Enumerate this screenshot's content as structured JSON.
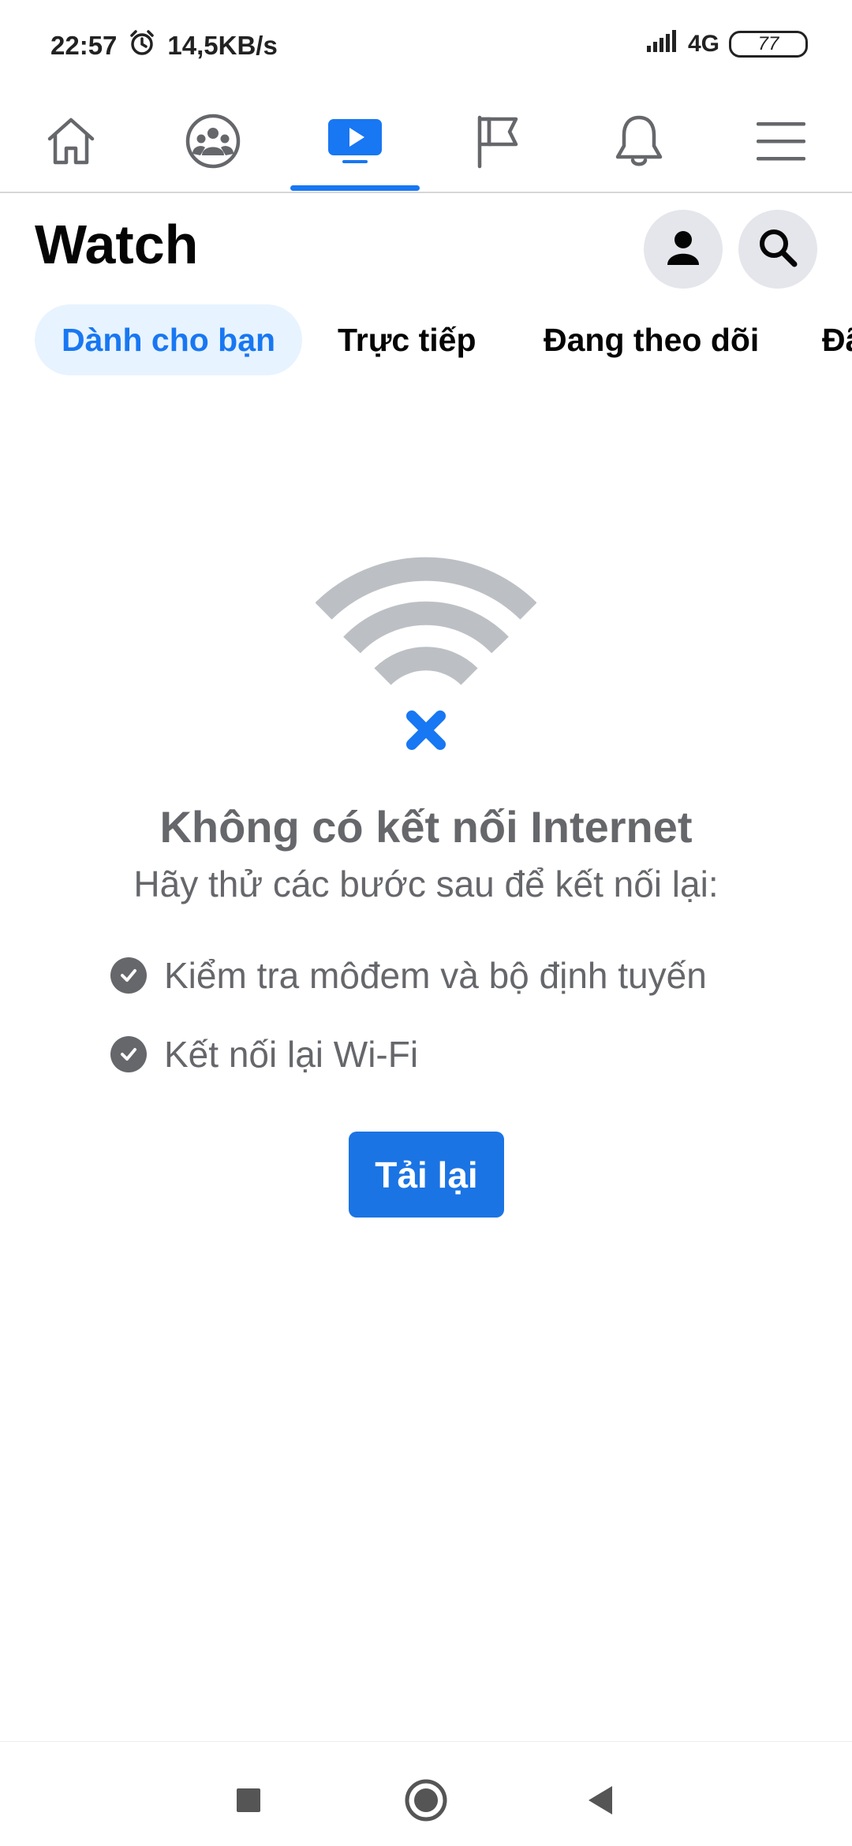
{
  "status_bar": {
    "time": "22:57",
    "net_speed": "14,5KB/s",
    "network": "4G",
    "battery": "77",
    "icons": [
      "alarm-icon",
      "signal-icon",
      "battery-icon"
    ]
  },
  "nav": {
    "tabs": [
      {
        "name": "home",
        "icon": "home-icon"
      },
      {
        "name": "groups",
        "icon": "groups-icon"
      },
      {
        "name": "watch",
        "icon": "watch-icon",
        "active": true
      },
      {
        "name": "pages",
        "icon": "flag-icon"
      },
      {
        "name": "notifications",
        "icon": "bell-icon"
      },
      {
        "name": "menu",
        "icon": "menu-icon"
      }
    ],
    "accent_color": "#1877f2"
  },
  "header": {
    "title": "Watch",
    "actions": [
      "profile-icon",
      "search-icon"
    ]
  },
  "chips": [
    {
      "label": "Dành cho bạn",
      "active": true
    },
    {
      "label": "Trực tiếp"
    },
    {
      "label": "Đang theo dõi"
    },
    {
      "label": "Đã"
    }
  ],
  "offline": {
    "title": "Không có kết nối Internet",
    "subtitle": "Hãy thử các bước sau để kết nối lại:",
    "steps": [
      "Kiểm tra môđem và bộ định tuyến",
      "Kết nối lại Wi-Fi"
    ],
    "reload_label": "Tải lại",
    "icon": "wifi-off-icon"
  },
  "system_nav": [
    "recents-button",
    "home-button",
    "back-button"
  ]
}
